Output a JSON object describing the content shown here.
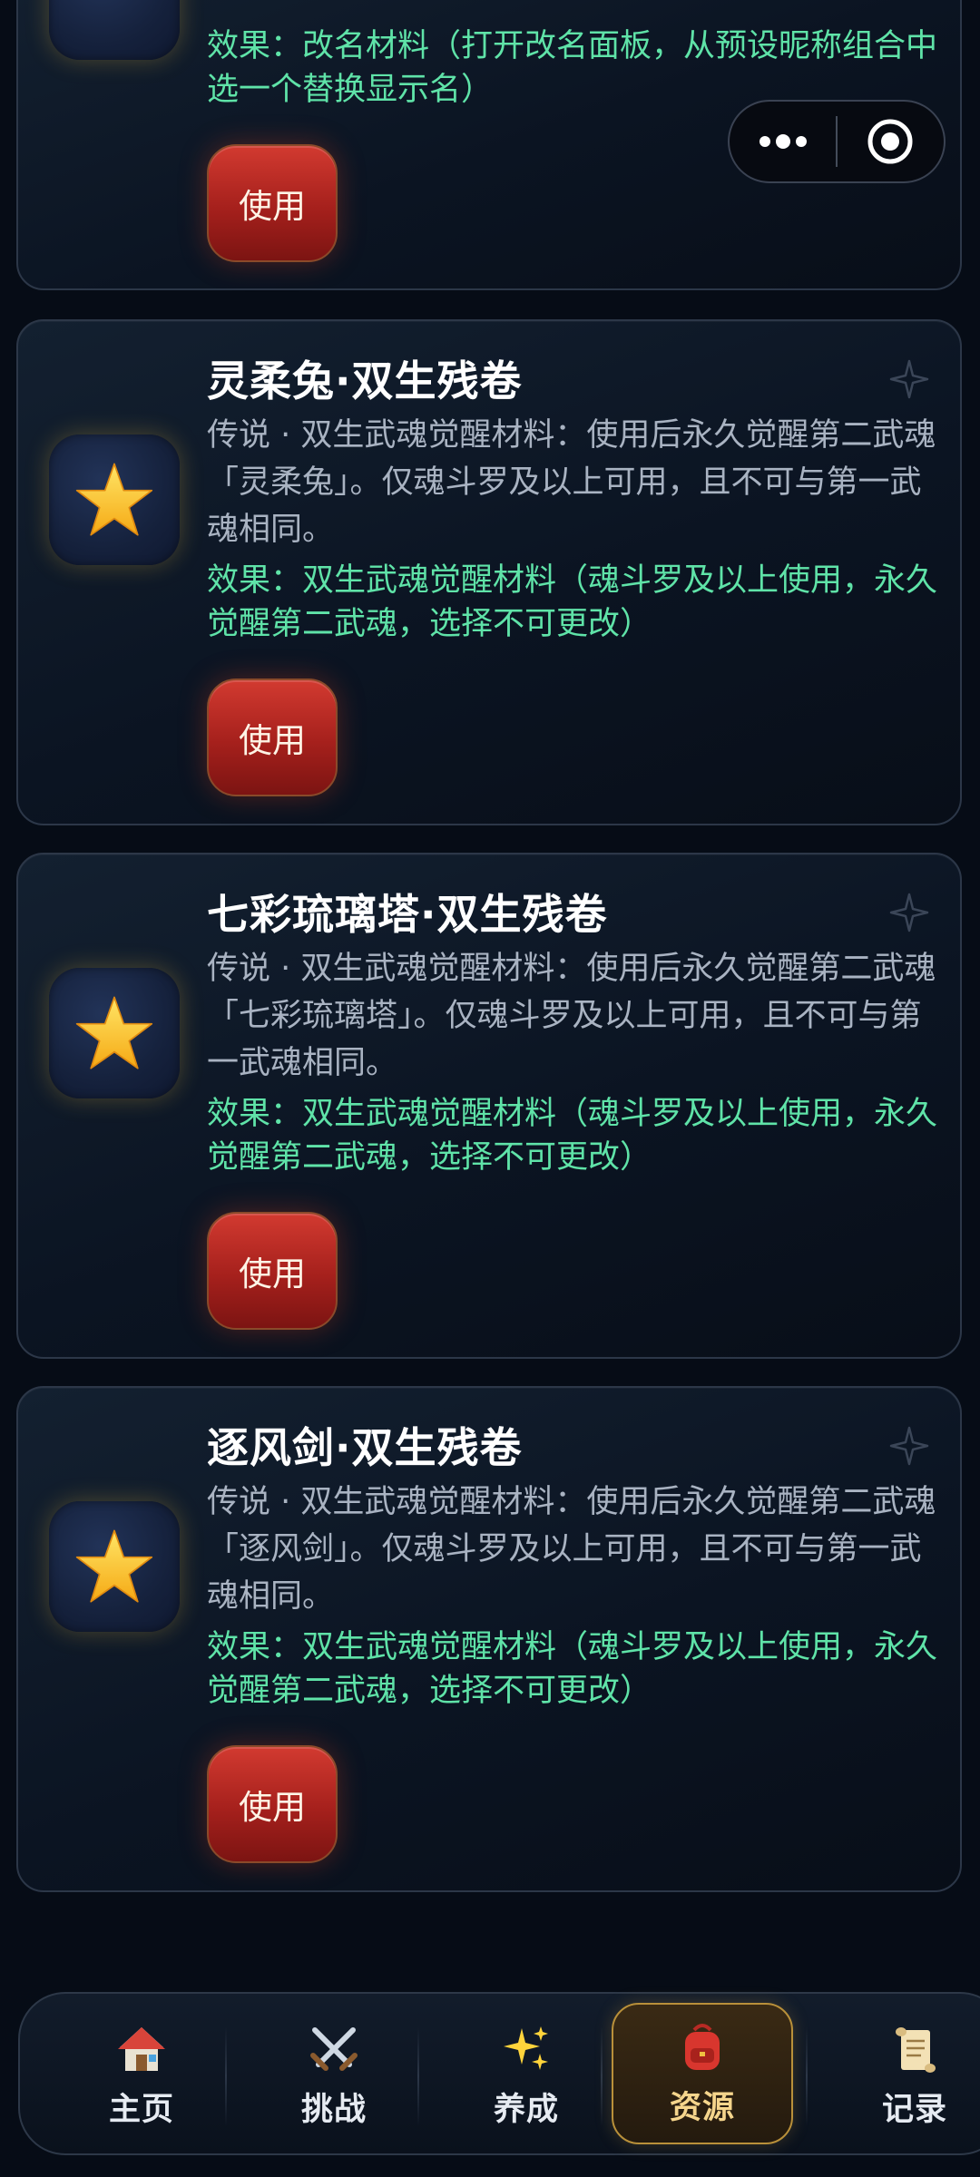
{
  "capsule": {
    "more_icon": "ellipsis-icon",
    "close_icon": "target-icon"
  },
  "items": [
    {
      "title": "",
      "desc": "",
      "effect": "效果：改名材料（打开改名面板，从预设昵称组合中选一个替换显示名）",
      "use_label": "使用",
      "icon": "card-icon-partial"
    },
    {
      "title": "灵柔兔·双生残卷",
      "desc": "传说 · 双生武魂觉醒材料：使用后永久觉醒第二武魂「灵柔兔」。仅魂斗罗及以上可用，且不可与第一武魂相同。",
      "effect": "效果：双生武魂觉醒材料（魂斗罗及以上使用，永久觉醒第二武魂，选择不可更改）",
      "use_label": "使用",
      "icon": "star-icon"
    },
    {
      "title": "七彩琉璃塔·双生残卷",
      "desc": "传说 · 双生武魂觉醒材料：使用后永久觉醒第二武魂「七彩琉璃塔」。仅魂斗罗及以上可用，且不可与第一武魂相同。",
      "effect": "效果：双生武魂觉醒材料（魂斗罗及以上使用，永久觉醒第二武魂，选择不可更改）",
      "use_label": "使用",
      "icon": "star-icon"
    },
    {
      "title": "逐风剑·双生残卷",
      "desc": "传说 · 双生武魂觉醒材料：使用后永久觉醒第二武魂「逐风剑」。仅魂斗罗及以上可用，且不可与第一武魂相同。",
      "effect": "效果：双生武魂觉醒材料（魂斗罗及以上使用，永久觉醒第二武魂，选择不可更改）",
      "use_label": "使用",
      "icon": "star-icon"
    }
  ],
  "tabbar": {
    "active_index": 3,
    "tabs": [
      {
        "label": "主页",
        "icon": "house-icon"
      },
      {
        "label": "挑战",
        "icon": "crossed-swords-icon"
      },
      {
        "label": "养成",
        "icon": "sparkles-icon"
      },
      {
        "label": "资源",
        "icon": "backpack-icon"
      },
      {
        "label": "记录",
        "icon": "scroll-icon"
      }
    ]
  },
  "colors": {
    "background": "#060c16",
    "effect_text": "#5fe3a8",
    "use_button": "#c42c24",
    "active_tab_border": "#b9903a"
  }
}
